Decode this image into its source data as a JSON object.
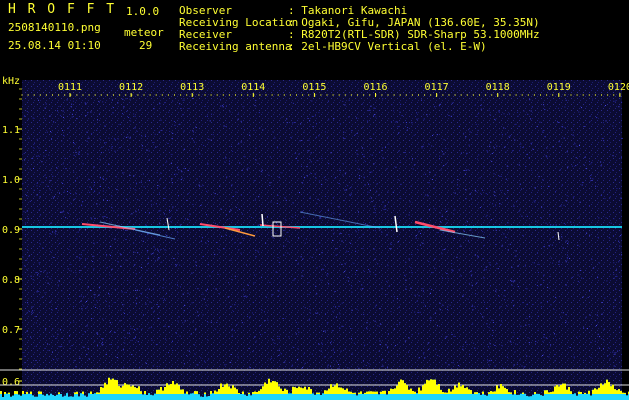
{
  "app": {
    "logo": "H R O F F T",
    "version": "1.0.0",
    "filename": "2508140110.png",
    "datetime": "25.08.14 01:10",
    "meteor_label": "meteor",
    "meteor_count": "29"
  },
  "info": {
    "labels": [
      "Observer",
      "Receiving Location",
      "Receiver",
      "Receiving antenna"
    ],
    "values": [
      ": Takanori Kawachi",
      ": Ogaki, Gifu, JAPAN (136.60E, 35.35N)",
      ": R820T2(RTL-SDR) SDR-Sharp 53.1000MHz",
      ": 2el-HB9CV Vertical (el. E-W)"
    ]
  },
  "spectrogram": {
    "y_unit": "kHz",
    "y_ticks": [
      "1.1",
      "1.0",
      "0.9",
      "0.8",
      "0.7",
      "0.6"
    ],
    "extra_y_tick": "0.6",
    "x_ticks": [
      "0111",
      "0112",
      "0113",
      "0114",
      "0115",
      "0116",
      "0117",
      "0118",
      "0119",
      "0120"
    ],
    "colors": {
      "background": "#0a0a2e",
      "text": "#ffff33",
      "signal": "#19e6ff",
      "histogram": "#ffff00"
    }
  }
}
